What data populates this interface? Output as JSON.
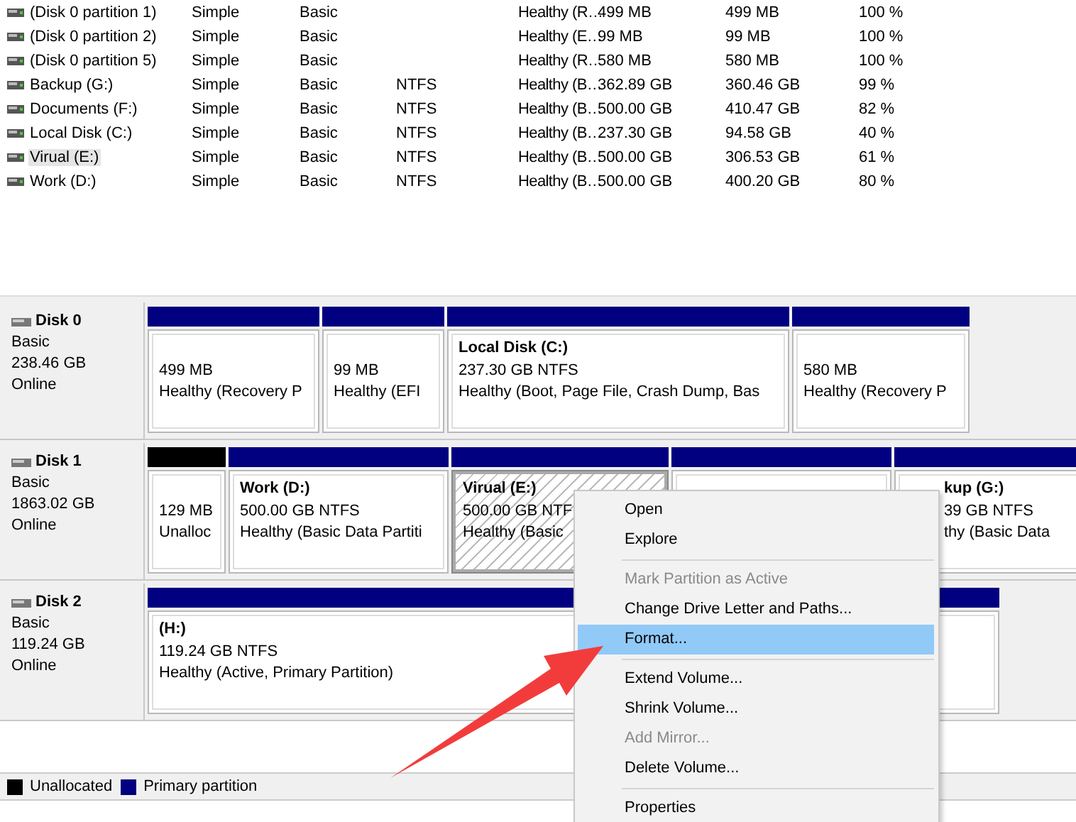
{
  "volumes": [
    {
      "cells": [
        "(Disk 0 partition 1)",
        "Simple",
        "Basic",
        null,
        "Healthy (R…",
        "499 MB",
        "499 MB",
        "100 %"
      ],
      "selected": false
    },
    {
      "cells": [
        "(Disk 0 partition 2)",
        "Simple",
        "Basic",
        null,
        "Healthy (E…",
        "99 MB",
        "99 MB",
        "100 %"
      ],
      "selected": false
    },
    {
      "cells": [
        "(Disk 0 partition 5)",
        "Simple",
        "Basic",
        null,
        "Healthy (R…",
        "580 MB",
        "580 MB",
        "100 %"
      ],
      "selected": false
    },
    {
      "cells": [
        "Backup (G:)",
        "Simple",
        "Basic",
        "NTFS",
        "Healthy (B…",
        "362.89 GB",
        "360.46 GB",
        "99 %"
      ],
      "selected": false
    },
    {
      "cells": [
        "Documents (F:)",
        "Simple",
        "Basic",
        "NTFS",
        "Healthy (B…",
        "500.00 GB",
        "410.47 GB",
        "82 %"
      ],
      "selected": false
    },
    {
      "cells": [
        "Local Disk (C:)",
        "Simple",
        "Basic",
        "NTFS",
        "Healthy (B…",
        "237.30 GB",
        "94.58 GB",
        "40 %"
      ],
      "selected": false
    },
    {
      "cells": [
        "Virual (E:)",
        "Simple",
        "Basic",
        "NTFS",
        "Healthy (B…",
        "500.00 GB",
        "306.53 GB",
        "61 %"
      ],
      "selected": true
    },
    {
      "cells": [
        "Work (D:)",
        "Simple",
        "Basic",
        "NTFS",
        "Healthy (B…",
        "500.00 GB",
        "400.20 GB",
        "80 %"
      ],
      "selected": false
    }
  ],
  "disks": [
    {
      "name": "Disk 0",
      "type": "Basic",
      "size": "238.46 GB",
      "status": "Online",
      "partitions": [
        {
          "kind": "primary",
          "lines": [
            "499 MB",
            "Healthy (Recovery P"
          ],
          "selected": false
        },
        {
          "kind": "primary",
          "lines": [
            "99 MB",
            "Healthy (EFI"
          ],
          "selected": false
        },
        {
          "kind": "primary",
          "title": "Local Disk  (C:)",
          "lines": [
            "237.30 GB NTFS",
            "Healthy (Boot, Page File, Crash Dump, Bas"
          ],
          "selected": false
        },
        {
          "kind": "primary",
          "lines": [
            "580 MB",
            "Healthy (Recovery P"
          ],
          "selected": false
        }
      ]
    },
    {
      "name": "Disk 1",
      "type": "Basic",
      "size": "1863.02 GB",
      "status": "Online",
      "partitions": [
        {
          "kind": "unallocated",
          "lines": [
            "129 MB",
            "Unalloc"
          ],
          "selected": false
        },
        {
          "kind": "primary",
          "title": "Work  (D:)",
          "lines": [
            "500.00 GB NTFS",
            "Healthy (Basic Data Partiti"
          ],
          "selected": false
        },
        {
          "kind": "primary",
          "title": "Virual  (E:)",
          "lines": [
            "500.00 GB NTF",
            "Healthy (Basic"
          ],
          "selected": true
        },
        {
          "kind": "primary",
          "selected": false
        },
        {
          "kind": "primary",
          "title": "kup  (G:)",
          "lines": [
            "39 GB NTFS",
            "thy (Basic Data"
          ],
          "selected": false
        }
      ]
    },
    {
      "name": "Disk 2",
      "type": "Basic",
      "size": "119.24 GB",
      "status": "Online",
      "partitions": [
        {
          "kind": "primary",
          "title": "(H:)",
          "lines": [
            "119.24 GB NTFS",
            "Healthy (Active, Primary Partition)"
          ],
          "selected": false
        }
      ]
    }
  ],
  "legend": [
    {
      "label": "Unallocated",
      "color": "#000000"
    },
    {
      "label": "Primary partition",
      "color": "#000080"
    }
  ],
  "context_menu": [
    {
      "kind": "item",
      "label": "Open",
      "disabled": false,
      "selected": false
    },
    {
      "kind": "item",
      "label": "Explore",
      "disabled": false,
      "selected": false
    },
    {
      "kind": "separator"
    },
    {
      "kind": "item",
      "label": "Mark Partition as Active",
      "disabled": true,
      "selected": false
    },
    {
      "kind": "item",
      "label": "Change Drive Letter and Paths...",
      "disabled": false,
      "selected": false
    },
    {
      "kind": "item",
      "label": "Format...",
      "disabled": false,
      "selected": true
    },
    {
      "kind": "separator"
    },
    {
      "kind": "item",
      "label": "Extend Volume...",
      "disabled": false,
      "selected": false
    },
    {
      "kind": "item",
      "label": "Shrink Volume...",
      "disabled": false,
      "selected": false
    },
    {
      "kind": "item",
      "label": "Add Mirror...",
      "disabled": true,
      "selected": false
    },
    {
      "kind": "item",
      "label": "Delete Volume...",
      "disabled": false,
      "selected": false
    },
    {
      "kind": "separator"
    },
    {
      "kind": "item",
      "label": "Properties",
      "disabled": false,
      "selected": false
    }
  ]
}
